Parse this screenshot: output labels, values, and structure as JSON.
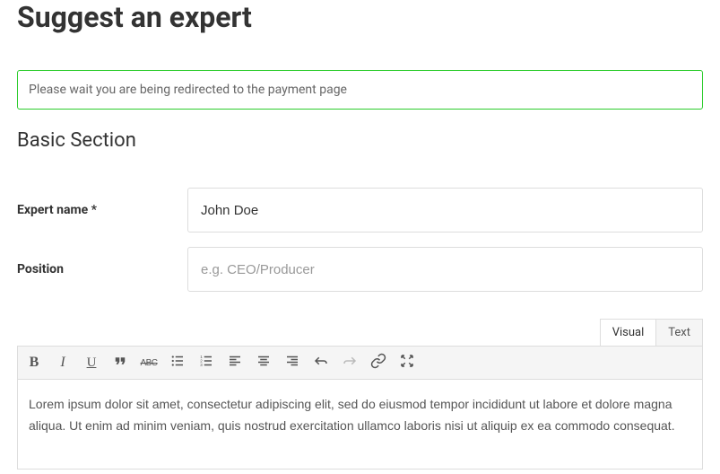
{
  "page": {
    "title": "Suggest an expert"
  },
  "alert": {
    "message": "Please wait you are being redirected to the payment page"
  },
  "section": {
    "heading": "Basic Section"
  },
  "form": {
    "expert_name": {
      "label": "Expert name *",
      "value": "John Doe"
    },
    "position": {
      "label": "Position",
      "placeholder": "e.g. CEO/Producer",
      "value": ""
    }
  },
  "editor": {
    "tabs": {
      "visual": "Visual",
      "text": "Text"
    },
    "toolbar": {
      "bold": "B",
      "italic": "I",
      "underline": "U",
      "strikethrough": "ABC"
    },
    "content": "Lorem ipsum dolor sit amet, consectetur adipiscing elit, sed do eiusmod tempor incididunt ut labore et dolore magna aliqua. Ut enim ad minim veniam, quis nostrud exercitation ullamco laboris nisi ut aliquip ex ea commodo consequat."
  }
}
